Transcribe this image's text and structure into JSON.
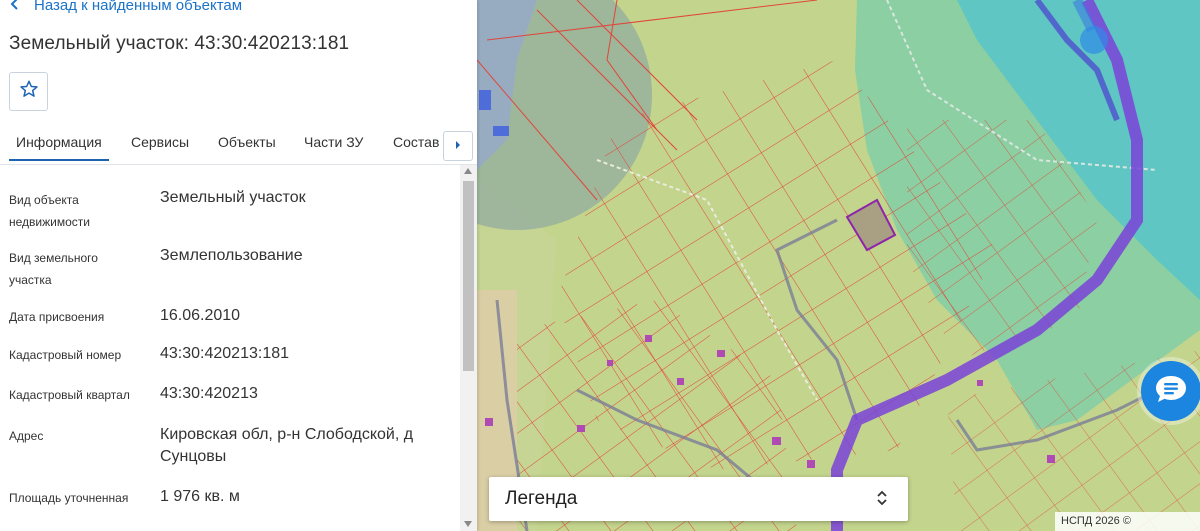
{
  "panel": {
    "back_label": "Назад к найденным объектам",
    "title": "Земельный участок: 43:30:420213:181"
  },
  "tabs": [
    {
      "label": "Информация",
      "active": true
    },
    {
      "label": "Сервисы"
    },
    {
      "label": "Объекты"
    },
    {
      "label": "Части ЗУ"
    },
    {
      "label": "Состав"
    }
  ],
  "details": [
    {
      "label": "Вид объекта недвижимости",
      "value": "Земельный участок"
    },
    {
      "label": "Вид земельного участка",
      "value": "Землепользование"
    },
    {
      "label": "Дата присвоения",
      "value": "16.06.2010"
    },
    {
      "label": "Кадастровый номер",
      "value": "43:30:420213:181"
    },
    {
      "label": "Кадастровый квартал",
      "value": "43:30:420213"
    },
    {
      "label": "Адрес",
      "value": "Кировская обл, р-н Слободской, д Сунцовы"
    },
    {
      "label": "Площадь уточненная",
      "value": "1 976 кв. м"
    }
  ],
  "map": {
    "legend_label": "Легенда",
    "copyright": "НСПД 2026 ©",
    "colors": {
      "zone_green": "#c3d48c",
      "zone_teal": "#53c5c6",
      "parcel_line": "#e0463a",
      "boundary_purple": "#7a42d8",
      "selected_parcel": "#8e24aa",
      "chat_button": "#1b85e0"
    }
  },
  "icons": {
    "back": "chevron-left-icon",
    "favorite": "star-outline-icon",
    "tabs_next": "chevron-right-icon",
    "legend_toggle": "chevron-up-down-icon",
    "chat": "chat-bubble-icon"
  }
}
